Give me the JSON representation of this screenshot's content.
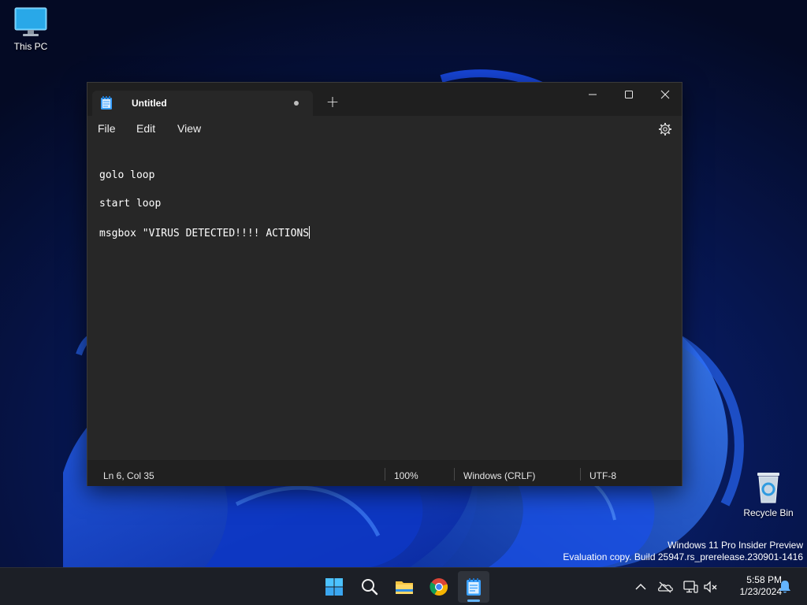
{
  "desktop": {
    "icons": [
      {
        "label": "This PC",
        "icon": "monitor-icon"
      },
      {
        "label": "Recycle Bin",
        "icon": "recycle-bin-icon"
      }
    ],
    "watermark": {
      "line1": "Windows 11 Pro Insider Preview",
      "line2": "Evaluation copy. Build 25947.rs_prerelease.230901-1416"
    }
  },
  "notepad": {
    "tab": {
      "title": "Untitled",
      "unsaved": true,
      "icon": "notepad-icon"
    },
    "new_tab_label": "+",
    "window_controls": [
      "minimize-icon",
      "maximize-icon",
      "close-icon"
    ],
    "menu": {
      "file": "File",
      "edit": "Edit",
      "view": "View"
    },
    "settings_icon": "gear-icon",
    "lines": [
      "",
      "golo loop",
      "",
      "start loop",
      "",
      "msgbox \"VIRUS DETECTED!!!! ACTIONS"
    ],
    "status": {
      "position": "Ln 6, Col 35",
      "zoom": "100%",
      "line_ending": "Windows (CRLF)",
      "encoding": "UTF-8"
    }
  },
  "taskbar": {
    "apps": [
      "windows-start-icon",
      "search-icon",
      "file-explorer-icon",
      "chrome-icon",
      "notepad-icon"
    ],
    "active_app": "notepad-icon",
    "tray_icons": [
      "chevron-up-icon",
      "onedrive-icon",
      "network-icon",
      "volume-muted-icon",
      "notification-bell-icon"
    ],
    "time": "5:58 PM",
    "date": "1/23/2024"
  },
  "colors": {
    "accent": "#63b4ff",
    "editor_bg": "#272727",
    "titlebar_bg": "#1f1f1f",
    "taskbar_bg": "#1c1f26"
  }
}
